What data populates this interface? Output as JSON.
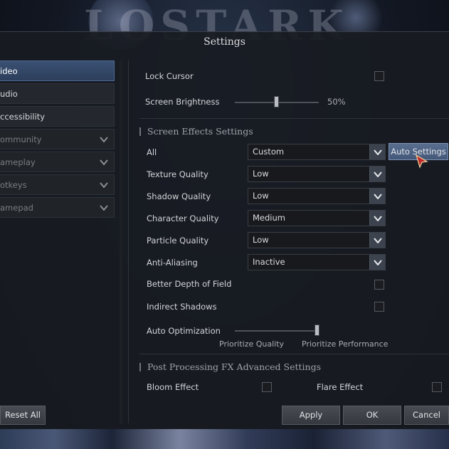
{
  "background": {
    "logo_text": "LOSTARK"
  },
  "window": {
    "title": "Settings"
  },
  "sidebar": {
    "items": [
      {
        "label": "ideo",
        "state": "active"
      },
      {
        "label": "udio",
        "state": "normal"
      },
      {
        "label": "ccessibility",
        "state": "normal"
      },
      {
        "label": "ommunity",
        "state": "collapsed",
        "icon": "chevron-down-icon"
      },
      {
        "label": "ameplay",
        "state": "collapsed",
        "icon": "chevron-down-icon"
      },
      {
        "label": "otkeys",
        "state": "collapsed",
        "icon": "chevron-down-icon"
      },
      {
        "label": "amepad",
        "state": "collapsed",
        "icon": "chevron-down-icon"
      }
    ]
  },
  "general": {
    "lock_cursor_label": "Lock Cursor",
    "lock_cursor_checked": false,
    "brightness_label": "Screen Brightness",
    "brightness_value": "50%",
    "brightness_fraction": 0.5
  },
  "screen_effects": {
    "section_title": "Screen Effects Settings",
    "rows": [
      {
        "label": "All",
        "value": "Custom"
      },
      {
        "label": "Texture Quality",
        "value": "Low"
      },
      {
        "label": "Shadow Quality",
        "value": "Low"
      },
      {
        "label": "Character Quality",
        "value": "Medium"
      },
      {
        "label": "Particle Quality",
        "value": "Low"
      },
      {
        "label": "Anti-Aliasing",
        "value": "Inactive"
      }
    ],
    "auto_settings_label": "Auto Settings",
    "depth_of_field_label": "Better Depth of Field",
    "depth_of_field_checked": false,
    "indirect_shadows_label": "Indirect Shadows",
    "indirect_shadows_checked": false,
    "auto_optimization_label": "Auto Optimization",
    "auto_optimization_fraction": 1.0,
    "prioritize_quality_label": "Prioritize Quality",
    "prioritize_performance_label": "Prioritize Performance"
  },
  "post_processing": {
    "section_title": "Post Processing FX Advanced Settings",
    "bloom_label": "Bloom Effect",
    "bloom_checked": false,
    "flare_label": "Flare Effect",
    "flare_checked": false
  },
  "footer": {
    "reset_label": "Reset All",
    "apply_label": "Apply",
    "ok_label": "OK",
    "cancel_label": "Cancel"
  },
  "colors": {
    "accent": "#3b5173",
    "auto_button": "#4e6385",
    "cursor_red": "#c0282c"
  }
}
